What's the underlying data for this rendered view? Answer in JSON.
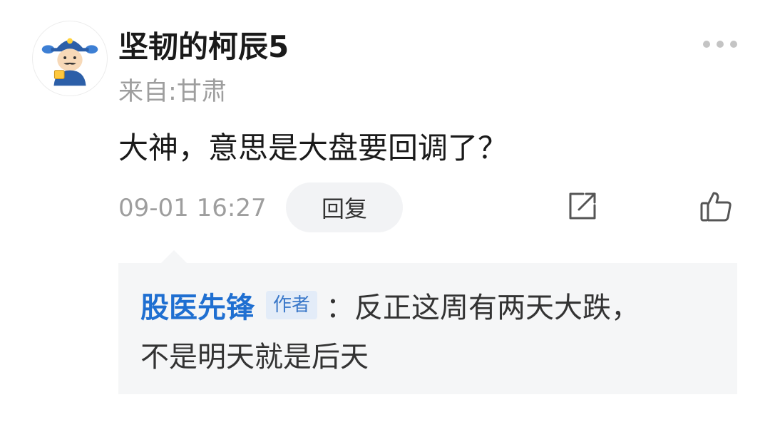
{
  "post": {
    "username": "坚韧的柯辰5",
    "location": "来自:甘肃",
    "comment": "大神，意思是大盘要回调了？",
    "timestamp": "09-01 16:27",
    "reply_button_label": "回复",
    "icons": {
      "avatar": "cartoon-avatar",
      "more": "more-dots-icon",
      "share": "share-icon",
      "like": "thumbs-up-icon"
    }
  },
  "reply": {
    "author": "股医先锋",
    "author_tag": "作者",
    "text_line1": "：反正这周有两天大跌，",
    "text_line2": "不是明天就是后天"
  },
  "colors": {
    "author_link": "#1f6fd1",
    "author_tag_bg": "#e3ecf8",
    "reply_bg": "#f5f6f7",
    "muted_text": "#9e9e9e"
  }
}
